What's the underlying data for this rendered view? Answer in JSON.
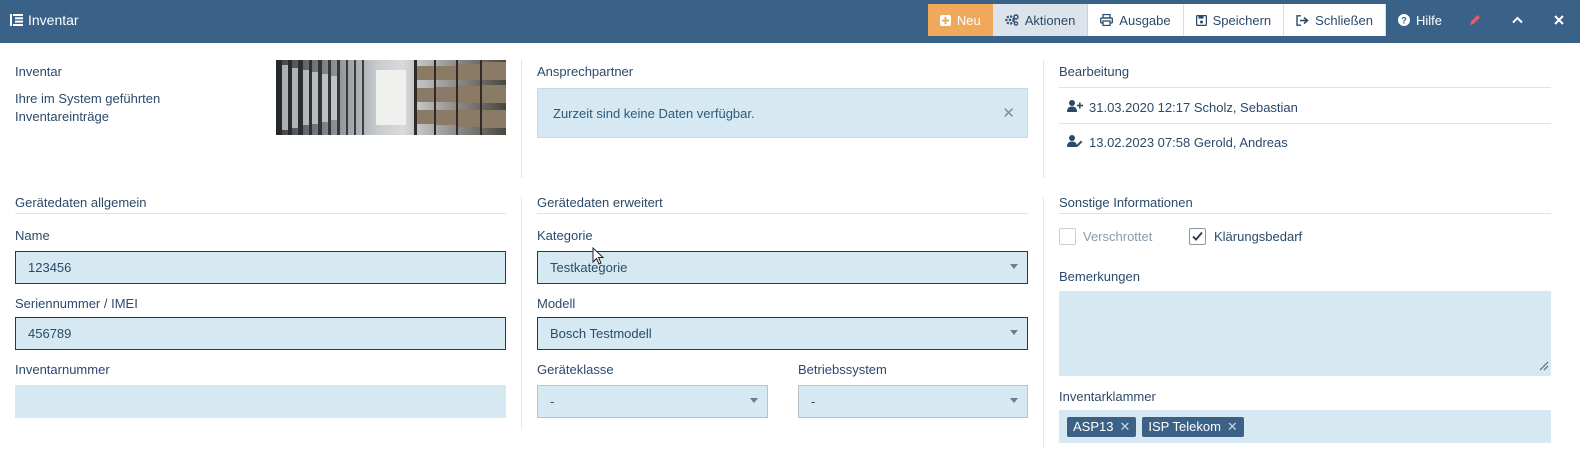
{
  "window": {
    "title": "Inventar"
  },
  "toolbar": {
    "new_label": "Neu",
    "actions_label": "Aktionen",
    "output_label": "Ausgabe",
    "save_label": "Speichern",
    "close_label": "Schließen",
    "help_label": "Hilfe"
  },
  "intro": {
    "title": "Inventar",
    "description": "Ihre im System geführten Inventareinträge"
  },
  "contact": {
    "title": "Ansprechpartner",
    "empty_message": "Zurzeit sind keine Daten verfügbar."
  },
  "edit_info": {
    "title": "Bearbeitung",
    "created": "31.03.2020 12:17 Scholz, Sebastian",
    "modified": "13.02.2023 07:58 Gerold, Andreas"
  },
  "general": {
    "title": "Gerätedaten allgemein",
    "name_label": "Name",
    "name_value": "123456",
    "serial_label": "Seriennummer / IMEI",
    "serial_value": "456789",
    "inventory_label": "Inventarnummer",
    "inventory_value": ""
  },
  "extended": {
    "title": "Gerätedaten erweitert",
    "category_label": "Kategorie",
    "category_value": "Testkategorie",
    "model_label": "Modell",
    "model_value": "Bosch Testmodell",
    "class_label": "Geräteklasse",
    "class_value": "-",
    "os_label": "Betriebssystem",
    "os_value": "-"
  },
  "other": {
    "title": "Sonstige Informationen",
    "scrapped_label": "Verschrottet",
    "scrapped_checked": false,
    "clarify_label": "Klärungsbedarf",
    "clarify_checked": true,
    "remarks_label": "Bemerkungen",
    "remarks_value": "",
    "tags_label": "Inventarklammer",
    "tags": [
      "ASP13",
      "ISP Telekom"
    ]
  },
  "colors": {
    "header": "#3a6187",
    "accent_new": "#f0a95a",
    "field_bg": "#d6e9f3",
    "text": "#2b4a6a",
    "tag_bg": "#3b6186",
    "edit_icon": "#e45c6c"
  }
}
